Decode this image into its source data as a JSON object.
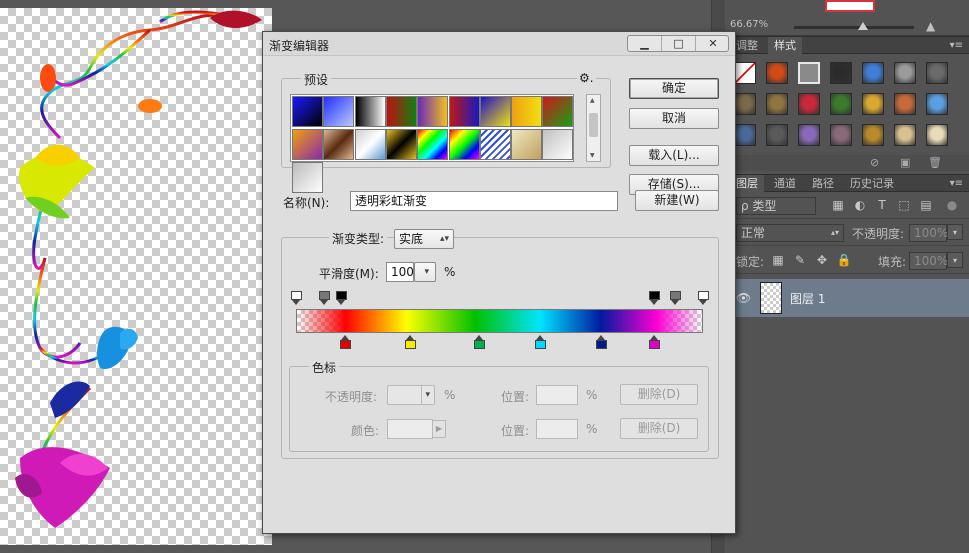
{
  "workspace": {
    "zoom_small": "66.67%"
  },
  "right_panel": {
    "tabs_top": [
      "调整",
      "样式"
    ],
    "style_colors": [
      "#ffffff",
      "#d24a16",
      "#cfcfcf",
      "#2b2b2b",
      "#3f7ed6",
      "#9a9a9a",
      "#6a6a6a",
      "#7a6a4a",
      "#8f7540",
      "#c8283a",
      "#3a7a2a",
      "#d8a830",
      "#c66a3a",
      "#5aa0e0",
      "#4a6a9a",
      "#5a5a5a",
      "#8a6ab8",
      "#8a6a7a",
      "#b88a2a",
      "#d8c090",
      "#e8dcb8"
    ],
    "layers_tabs": [
      "图层",
      "通道",
      "路径",
      "历史记录"
    ],
    "kind_label": "ρ 类型",
    "blend_mode": "正常",
    "opacity_label": "不透明度:",
    "opacity_value": "100%",
    "lock_label": "锁定:",
    "fill_label": "填充:",
    "fill_value": "100%",
    "layer_name": "图层 1"
  },
  "dialog": {
    "title": "渐变编辑器",
    "win_minimize": "▁",
    "win_maximize": "□",
    "win_close": "✕",
    "presets_label": "预设",
    "presets_gear": "⚙.",
    "preset_swatches": [
      "linear-gradient(135deg,#1a1aff,#000)",
      "linear-gradient(135deg,#2030ff,#bcc8ff)",
      "linear-gradient(90deg,#000,#fff)",
      "linear-gradient(90deg,#c01010,#108010)",
      "linear-gradient(90deg,#6a2ab8,#f2c020)",
      "linear-gradient(90deg,#c01818,#1818c0)",
      "linear-gradient(135deg,#2010c8,#f0e010)",
      "linear-gradient(90deg,#f0a010,#f0e010)",
      "linear-gradient(135deg,#d01818,#18a018)",
      "linear-gradient(135deg,#f0a010,#8a2aa8)",
      "linear-gradient(135deg,#e0b890,#5a2a10,#e0b890)",
      "linear-gradient(135deg,#d0d0d0,#fff,#5a9ad0)",
      "linear-gradient(135deg,#e8c020,#000,#e8c020)",
      "linear-gradient(135deg,#ff0000,#ffff00,#00ff00,#00ffff,#0000ff,#ff00ff)",
      "linear-gradient(135deg,#ff0000,#ffff00,#00ff00,#0000ff,#ff00ff)",
      "repeating-linear-gradient(135deg,#fff 0,#fff 3px,#3050d0 3px,#3050d0 5px)",
      "linear-gradient(135deg,#f0e8c0,#c0a060)",
      "linear-gradient(135deg,#c0c0c0,#fff)",
      "linear-gradient(135deg,#bbb,#fff)"
    ],
    "ok": "确定",
    "cancel": "取消",
    "load": "载入(L)...",
    "save": "存储(S)...",
    "name_label": "名称(N):",
    "name_value": "透明彩虹渐变",
    "new": "新建(W)",
    "type_label": "渐变类型:",
    "type_value": "实底",
    "smooth_label": "平滑度(M):",
    "smooth_value": "100",
    "smooth_unit": "%",
    "opacity_stops": [
      {
        "pos": 0,
        "color": "#ffffff"
      },
      {
        "pos": 7,
        "color": "#777777"
      },
      {
        "pos": 11,
        "color": "#000000"
      },
      {
        "pos": 88,
        "color": "#000000"
      },
      {
        "pos": 93,
        "color": "#777777"
      },
      {
        "pos": 100,
        "color": "#ffffff"
      }
    ],
    "color_stops": [
      {
        "pos": 12,
        "color": "#e30000"
      },
      {
        "pos": 28,
        "color": "#f5ec00"
      },
      {
        "pos": 45,
        "color": "#00b050"
      },
      {
        "pos": 60,
        "color": "#00d8ff"
      },
      {
        "pos": 75,
        "color": "#001a8a"
      },
      {
        "pos": 88,
        "color": "#e000c8"
      }
    ],
    "stops_group_label": "色标",
    "stop_opacity_label": "不透明度:",
    "stop_opacity_unit": "%",
    "stop_position_label": "位置:",
    "stop_position_unit": "%",
    "stop_delete": "删除(D)",
    "stop_color_label": "颜色:",
    "color_position_label": "位置:",
    "color_position_unit": "%",
    "color_delete": "删除(D)"
  }
}
